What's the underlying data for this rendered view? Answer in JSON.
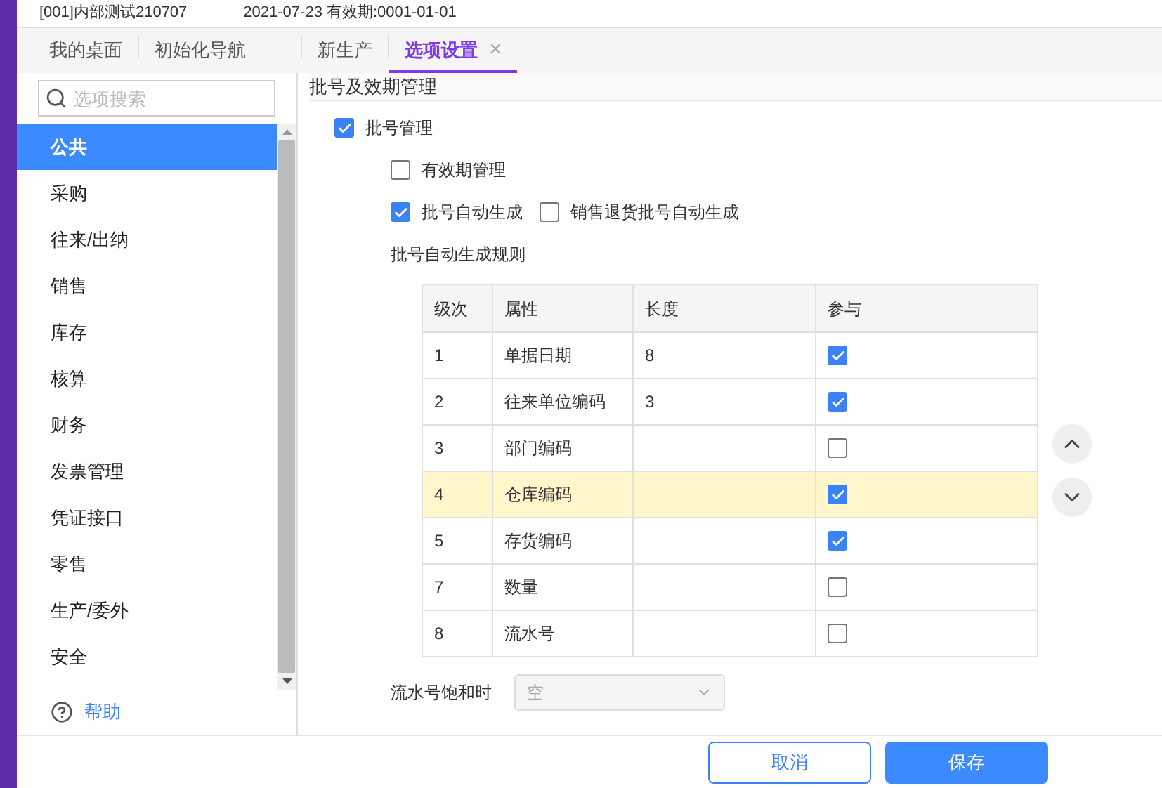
{
  "header": {
    "account": "[001]内部测试210707",
    "date_info": "2021-07-23  有效期:0001-01-01"
  },
  "tabs": [
    {
      "label": "我的桌面",
      "selected": false,
      "closable": false
    },
    {
      "label": "初始化导航",
      "selected": false,
      "closable": false
    },
    {
      "label": "新生产",
      "selected": false,
      "closable": false
    },
    {
      "label": "选项设置",
      "selected": true,
      "closable": true,
      "close": "×"
    }
  ],
  "sidebar": {
    "search_placeholder": "选项搜索",
    "items": [
      {
        "label": "公共",
        "selected": true
      },
      {
        "label": "采购",
        "selected": false
      },
      {
        "label": "往来/出纳",
        "selected": false
      },
      {
        "label": "销售",
        "selected": false
      },
      {
        "label": "库存",
        "selected": false
      },
      {
        "label": "核算",
        "selected": false
      },
      {
        "label": "财务",
        "selected": false
      },
      {
        "label": "发票管理",
        "selected": false
      },
      {
        "label": "凭证接口",
        "selected": false
      },
      {
        "label": "零售",
        "selected": false
      },
      {
        "label": "生产/委外",
        "selected": false
      },
      {
        "label": "安全",
        "selected": false
      }
    ],
    "help": "帮助"
  },
  "section_title": "批号及效期管理",
  "batch_management": {
    "label": "批号管理",
    "checked": true
  },
  "expiry_management": {
    "label": "有效期管理",
    "checked": false
  },
  "auto_batch": {
    "label": "批号自动生成",
    "checked": true
  },
  "return_auto_batch": {
    "label": "销售退货批号自动生成",
    "checked": false
  },
  "rules_title": "批号自动生成规则",
  "table": {
    "columns": [
      "级次",
      "属性",
      "长度",
      "参与"
    ],
    "rows": [
      {
        "level": "1",
        "attribute": "单据日期",
        "length": "8",
        "included": true,
        "selected": false
      },
      {
        "level": "2",
        "attribute": "往来单位编码",
        "length": "3",
        "included": true,
        "selected": false
      },
      {
        "level": "3",
        "attribute": "部门编码",
        "length": "",
        "included": false,
        "selected": false
      },
      {
        "level": "4",
        "attribute": "仓库编码",
        "length": "",
        "included": true,
        "selected": true
      },
      {
        "level": "5",
        "attribute": "存货编码",
        "length": "",
        "included": true,
        "selected": false
      },
      {
        "level": "7",
        "attribute": "数量",
        "length": "",
        "included": false,
        "selected": false
      },
      {
        "level": "8",
        "attribute": "流水号",
        "length": "",
        "included": false,
        "selected": false
      }
    ]
  },
  "serial_full": {
    "label": "流水号饱和时",
    "value": "空",
    "disabled": true
  },
  "buttons": [
    {
      "label": "取消",
      "kind": "secondary"
    },
    {
      "label": "保存",
      "kind": "primary"
    }
  ]
}
